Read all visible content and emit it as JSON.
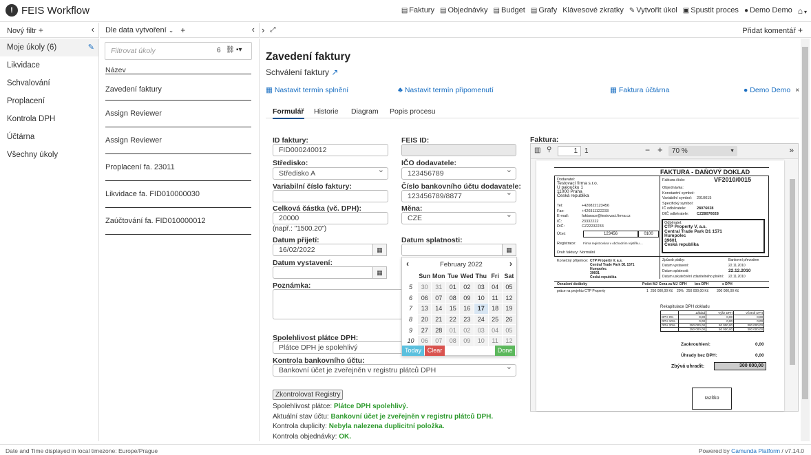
{
  "app_title": "FEIS Workflow",
  "topnav": [
    {
      "icon": "invoice-icon",
      "label": "Faktury"
    },
    {
      "icon": "order-icon",
      "label": "Objednávky"
    },
    {
      "icon": "budget-icon",
      "label": "Budget"
    },
    {
      "icon": "chart-icon",
      "label": "Grafy"
    },
    {
      "icon": "",
      "label": "Klávesové zkratky"
    },
    {
      "icon": "pencil-icon",
      "label": "Vytvořit úkol"
    },
    {
      "icon": "process-icon",
      "label": "Spustit proces"
    },
    {
      "icon": "user-icon",
      "label": "Demo Demo"
    }
  ],
  "headers": {
    "filter_new": "Nový filtr",
    "sort_label": "Dle data vytvoření",
    "add_comment": "Přidat komentář"
  },
  "sidebar": {
    "items": [
      "Moje úkoly (6)",
      "Likvidace",
      "Schvalování",
      "Proplacení",
      "Kontrola DPH",
      "Účtárna",
      "Všechny úkoly"
    ]
  },
  "tasklist": {
    "filter_placeholder": "Filtrovat úkoly",
    "filter_count": "6",
    "column_header": "Název",
    "items": [
      "Zavedení faktury",
      "Assign Reviewer",
      "Assign Reviewer",
      "Proplacení fa. 23011",
      "Likvidace fa. FID010000030",
      "Zaúčtování fa. FID010000012"
    ]
  },
  "task": {
    "title": "Zavedení faktury",
    "subtitle": "Schválení faktury",
    "actions": {
      "due_date": "Nastavit termín splnění",
      "reminder": "Nastavit termín připomenutí",
      "accounting": "Faktura účtárna",
      "assignee": "Demo Demo"
    },
    "tabs": [
      "Formulář",
      "Historie",
      "Diagram",
      "Popis procesu"
    ]
  },
  "form": {
    "id_label": "ID faktury:",
    "id_value": "FID000240012",
    "feis_label": "FEIS ID:",
    "feis_value": "",
    "center_label": "Středisko:",
    "center_value": "Středisko A",
    "ico_label": "IČO dodavatele:",
    "ico_value": "123456789",
    "varsym_label": "Variabilní číslo faktury:",
    "varsym_value": "",
    "account_label": "Číslo bankovního účtu dodavatele:",
    "account_value": "123456789/8877",
    "amount_label": "Celková částka (vč. DPH):",
    "amount_value": "20000",
    "amount_hint": "(např.: \"1500.20\")",
    "currency_label": "Měna:",
    "currency_value": "CZE",
    "received_label": "Datum přijetí:",
    "received_value": "16/02/2022",
    "due_label": "Datum splatnosti:",
    "due_value": "",
    "issued_label": "Datum vystavení:",
    "issued_value": "",
    "note_label": "Poznámka:",
    "reliability_label": "Spolehlivost plátce DPH:",
    "reliability_value": "Plátce DPH je spolehlivý",
    "bankcheck_label": "Kontrola bankovního účtu:",
    "bankcheck_value": "Bankovní účet je zveřejněn v registru plátců DPH",
    "check_button": "Zkontrolovat Registry",
    "results": [
      {
        "label": "Spolehlivost plátce:",
        "value": "Plátce DPH spolehlivý."
      },
      {
        "label": "Aktuální stav účtu:",
        "value": "Bankovní účet je zveřejněn v registru plátců DPH."
      },
      {
        "label": "Kontrola duplicity:",
        "value": "Nebyla nalezena duplicitní položka."
      },
      {
        "label": "Kontrola objednávky:",
        "value": "OK."
      }
    ]
  },
  "datepicker": {
    "month": "February 2022",
    "weekdays": [
      "Sun",
      "Mon",
      "Tue",
      "Wed",
      "Thu",
      "Fri",
      "Sat"
    ],
    "weeks": [
      {
        "wk": "5",
        "days": [
          "30",
          "31",
          "01",
          "02",
          "03",
          "04",
          "05"
        ]
      },
      {
        "wk": "6",
        "days": [
          "06",
          "07",
          "08",
          "09",
          "10",
          "11",
          "12"
        ]
      },
      {
        "wk": "7",
        "days": [
          "13",
          "14",
          "15",
          "16",
          "17",
          "18",
          "19"
        ]
      },
      {
        "wk": "8",
        "days": [
          "20",
          "21",
          "22",
          "23",
          "24",
          "25",
          "26"
        ]
      },
      {
        "wk": "9",
        "days": [
          "27",
          "28",
          "01",
          "02",
          "03",
          "04",
          "05"
        ]
      },
      {
        "wk": "10",
        "days": [
          "06",
          "07",
          "08",
          "09",
          "10",
          "11",
          "12"
        ]
      }
    ],
    "today_label": "Today",
    "clear_label": "Clear",
    "done_label": "Done",
    "colors": {
      "today": "#5bc0de",
      "clear": "#d9534f",
      "done": "#5cb85c"
    }
  },
  "pdf": {
    "label": "Faktura:",
    "page_current": "1",
    "page_total": "1",
    "zoom": "70 %",
    "doc_title": "FAKTURA - DAŇOVÝ DOKLAD",
    "invoice_date_label": "Faktura číslo:",
    "invoice_number": "VF2010/0015",
    "supplier_label": "Dodavatel:",
    "supplier": [
      "Testovací firma s.r.o.",
      "U paloučku 1",
      "11000 Praha",
      "Česká republika"
    ],
    "supplier_fields": [
      {
        "k": "Tel:",
        "v": "+420822123456"
      },
      {
        "k": "Fax:",
        "v": "+420311122233"
      },
      {
        "k": "E-mail:",
        "v": "fakturace@testovaci.firma.cz"
      },
      {
        "k": "IČ:",
        "v": "23332222"
      },
      {
        "k": "DIČ:",
        "v": "CZ22232233"
      }
    ],
    "account_label": "Účet:",
    "account_box": "123456",
    "bank_box": "0100",
    "registration_label": "Registrace:",
    "registration": "Firma registrována v obchodním rejstříku ...",
    "right_fields": [
      {
        "k": "Objednávka:",
        "v": ""
      },
      {
        "k": "Konstantní symbol:",
        "v": ""
      },
      {
        "k": "Variabilní symbol:",
        "v": "2010015"
      },
      {
        "k": "Specifický symbol:",
        "v": ""
      },
      {
        "k": "IČ odběratele:",
        "v": "28076028"
      },
      {
        "k": "DIČ odběratele:",
        "v": "CZ28076028"
      }
    ],
    "customer_label": "Odběratel:",
    "customer": [
      "CTP Property V, a.s.",
      "Central Trade Park D1 1571",
      "Humpolec",
      "39601",
      "Česká republika"
    ],
    "payment_type_label": "Druh faktury:",
    "payment_type_value": "Normální",
    "end_customer_label": "Konečný příjemce:",
    "end_customer": [
      "CTP Property V, a.s.",
      "Central Trade Park D1 1571",
      "Humpolec",
      "39601",
      "Česká republika"
    ],
    "dates": [
      {
        "k": "Způsob platby:",
        "v": "Bankovní převodem"
      },
      {
        "k": "Datum vystavení:",
        "v": "22.11.2010"
      },
      {
        "k": "Datum splatnosti:",
        "v": "22.12.2010"
      },
      {
        "k": "Datum uskutečnění zdanitelného plnění:",
        "v": "22.11.2010"
      }
    ],
    "item_headers": [
      "Označení dodávky",
      "Počet MJ",
      "Cena za MJ",
      "DPH",
      "bez DPH",
      "s DPH"
    ],
    "item_row": [
      "práce na projektu CTP Property",
      "1",
      "250 000,00 Kč",
      "20%",
      "250 000,00 Kč",
      "300 000,00 Kč"
    ],
    "recap_title": "Rekapitulace DPH dokladu",
    "recap_headers": [
      "",
      "Základ",
      "Výše DPH",
      "Včetně DPH"
    ],
    "recap_rows": [
      [
        "DPH 0%",
        "0,00",
        "0,00",
        "0,00"
      ],
      [
        "DPH 10%",
        "0,00",
        "0,00",
        "0,00"
      ],
      [
        "DPH 20%",
        "250 000,00",
        "50 000,00",
        "300 000,00"
      ],
      [
        "",
        "250 000,00",
        "50 000,00",
        "300 000,00"
      ]
    ],
    "rounding_label": "Zaokrouhlení:",
    "rounding_value": "0,00",
    "paid_label": "Úhrady bez DPH:",
    "paid_value": "0,00",
    "remaining_label": "Zbývá uhradit:",
    "remaining_value": "300 000,00",
    "stamp": "razítko"
  },
  "footer": {
    "timezone": "Date and Time displayed in local timezone: Europe/Prague",
    "powered": "Powered by",
    "platform": "Camunda Platform",
    "version": " / v7.14.0"
  }
}
